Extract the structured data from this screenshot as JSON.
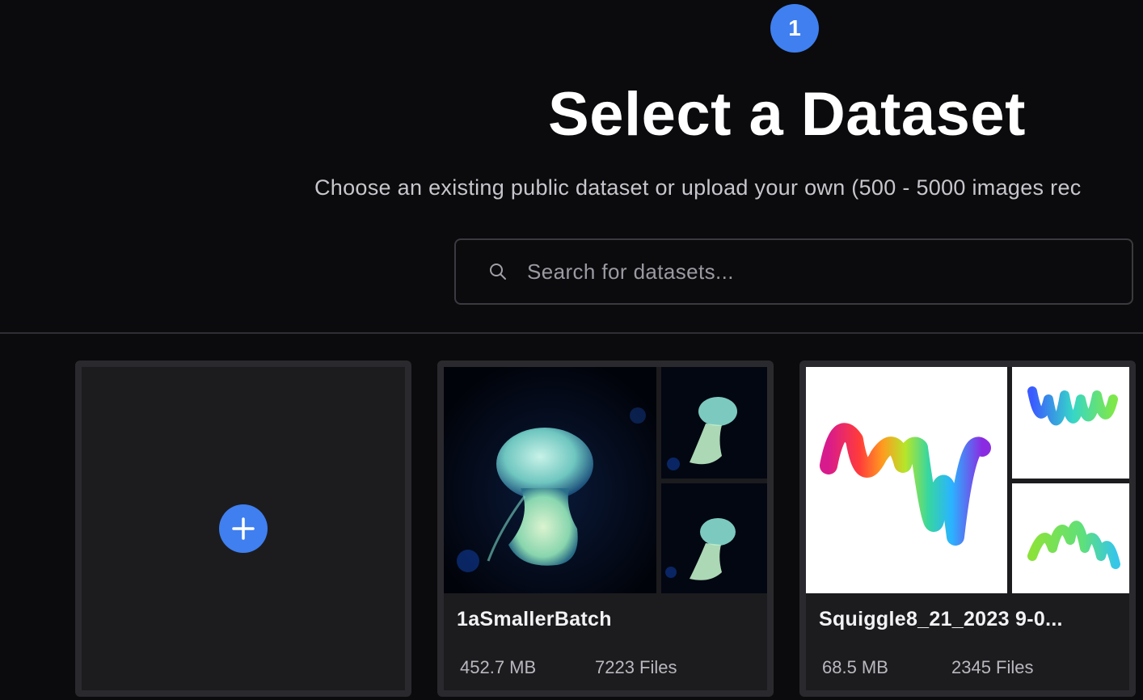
{
  "step": {
    "number": "1"
  },
  "header": {
    "title": "Select a Dataset",
    "subtitle": "Choose an existing public dataset or upload your own (500 - 5000 images rec"
  },
  "search": {
    "placeholder": "Search for datasets...",
    "value": ""
  },
  "colors": {
    "accent": "#3f7ff0",
    "background": "#0b0b0d",
    "card": "#1c1c1f"
  },
  "add_card": {
    "icon": "plus-icon"
  },
  "datasets": [
    {
      "name": "1aSmallerBatch",
      "size": "452.7 MB",
      "files": "7223 Files",
      "thumbnails": "jellyfish"
    },
    {
      "name": "Squiggle8_21_2023 9-0...",
      "size": "68.5 MB",
      "files": "2345 Files",
      "thumbnails": "rainbow-squiggle"
    }
  ]
}
